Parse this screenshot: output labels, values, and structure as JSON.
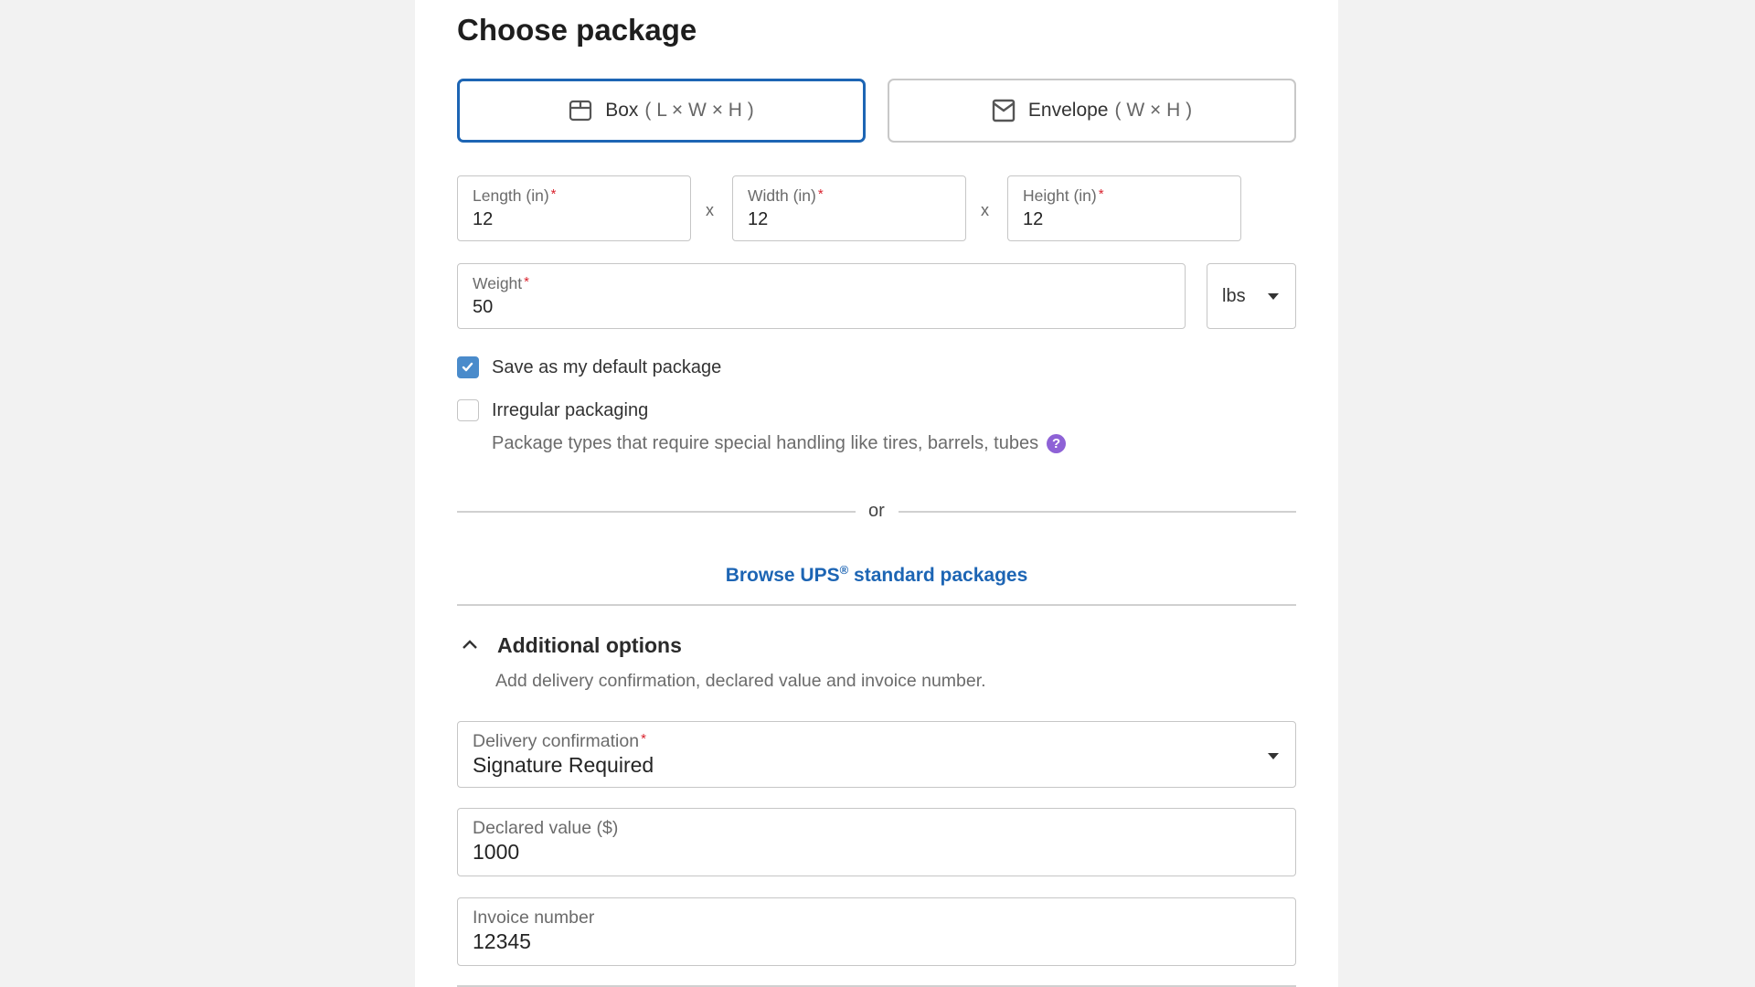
{
  "page": {
    "title": "Choose package"
  },
  "package_types": [
    {
      "label": "Box",
      "dims": "( L × W × H )",
      "icon": "box-icon",
      "selected": true
    },
    {
      "label": "Envelope",
      "dims": "( W × H )",
      "icon": "envelope-icon",
      "selected": false
    }
  ],
  "dimensions": {
    "separator": "x",
    "length": {
      "label": "Length (in)",
      "value": "12",
      "required": "*"
    },
    "width": {
      "label": "Width (in)",
      "value": "12",
      "required": "*"
    },
    "height": {
      "label": "Height (in)",
      "value": "12",
      "required": "*"
    }
  },
  "weight": {
    "label": "Weight",
    "value": "50",
    "required": "*",
    "unit": "lbs"
  },
  "checkboxes": {
    "save_default": {
      "label": "Save as my default package",
      "checked": true
    },
    "irregular": {
      "label": "Irregular packaging",
      "checked": false,
      "help_text": "Package types that require special handling like tires, barrels, tubes",
      "help_icon": "?"
    }
  },
  "divider": {
    "or_text": "or"
  },
  "browse_link": {
    "prefix": "Browse UPS",
    "registered": "®",
    "suffix": " standard packages"
  },
  "additional_options": {
    "title": "Additional options",
    "expanded": true,
    "subtitle": "Add delivery confirmation, declared value and invoice number.",
    "delivery_confirmation": {
      "label": "Delivery confirmation",
      "required": "*",
      "value": "Signature Required"
    },
    "declared_value": {
      "label": "Declared value ($)",
      "value": "1000"
    },
    "invoice_number": {
      "label": "Invoice number",
      "value": "12345"
    }
  },
  "colors": {
    "accent": "#1d65b4",
    "checkbox_checked": "#4a8bcb",
    "required": "#d9232e",
    "help_icon": "#8e62d6"
  }
}
